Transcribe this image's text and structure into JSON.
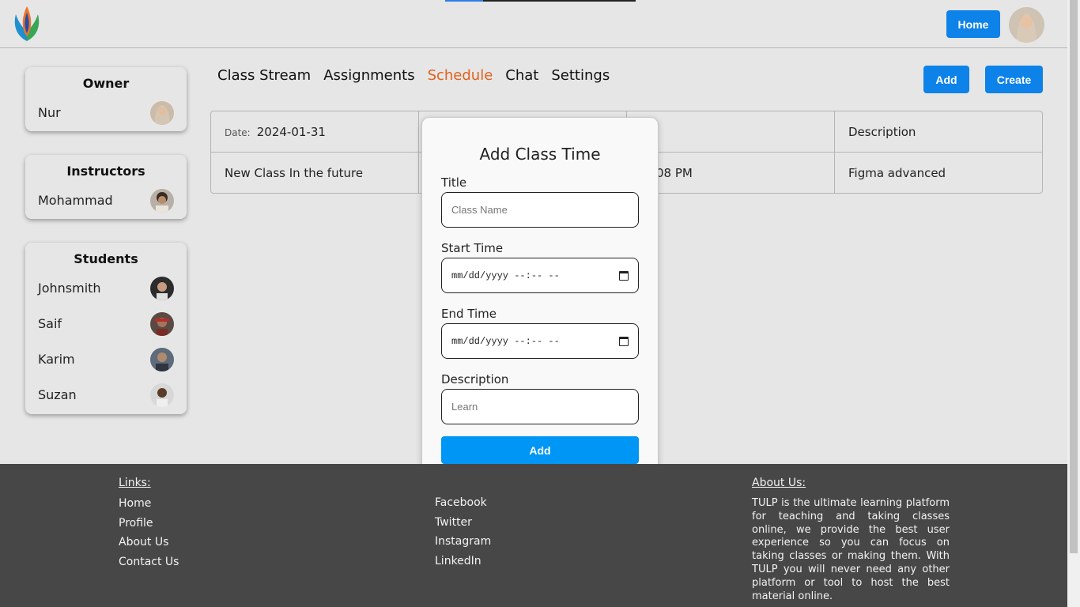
{
  "header": {
    "home_label": "Home"
  },
  "sidebar": {
    "owner": {
      "title": "Owner",
      "members": [
        {
          "name": "Nur"
        }
      ]
    },
    "instructors": {
      "title": "Instructors",
      "members": [
        {
          "name": "Mohammad"
        }
      ]
    },
    "students": {
      "title": "Students",
      "members": [
        {
          "name": "Johnsmith"
        },
        {
          "name": "Saif"
        },
        {
          "name": "Karim"
        },
        {
          "name": "Suzan"
        }
      ]
    }
  },
  "tabs": [
    {
      "label": "Class Stream"
    },
    {
      "label": "Assignments"
    },
    {
      "label": "Schedule",
      "active": true
    },
    {
      "label": "Chat"
    },
    {
      "label": "Settings"
    }
  ],
  "actions": {
    "add_label": "Add",
    "create_label": "Create"
  },
  "schedule": {
    "date_label": "Date:",
    "date_value": "2024-01-31",
    "description_header": "Description",
    "row": {
      "title": "New Class In the future",
      "time_fragment": "08 PM",
      "description": "Figma advanced"
    }
  },
  "modal": {
    "title": "Add Class Time",
    "title_label": "Title",
    "title_placeholder": "Class Name",
    "start_label": "Start Time",
    "start_value": "mm/dd/yyyy --:-- --",
    "end_label": "End Time",
    "end_value": "mm/dd/yyyy --:-- --",
    "description_label": "Description",
    "description_placeholder": "Learn",
    "submit_label": "Add"
  },
  "footer": {
    "links_title": "Links:",
    "links": [
      "Home",
      "Profile",
      "About Us",
      "Contact Us"
    ],
    "social": [
      "Facebook",
      "Twitter",
      "Instagram",
      "LinkedIn"
    ],
    "about_title": "About Us:",
    "about_text": "TULP is the ultimate learning platform for teaching and taking classes online, we provide the best user experience so you can focus on taking classes or making them. With TULP you will never need any other platform or tool to host the best material online."
  },
  "colors": {
    "primary": "#0d82e8",
    "active_tab": "#e0621a",
    "footer_bg": "#474747",
    "page_bg": "#e6e6e6"
  },
  "icons": [
    "tulp-logo",
    "user-avatar",
    "calendar-icon"
  ]
}
